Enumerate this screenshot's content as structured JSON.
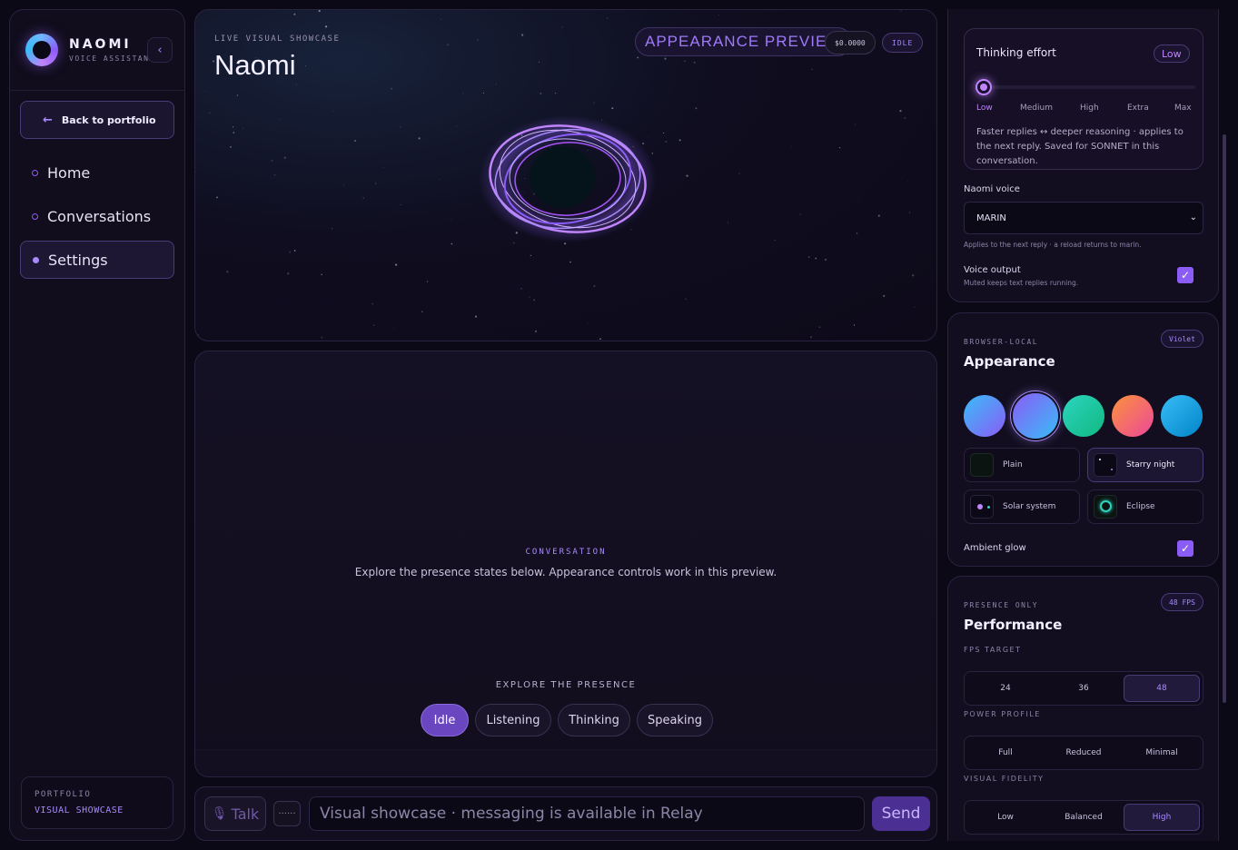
{
  "brand": {
    "name": "NAOMI",
    "subtitle": "VOICE ASSISTANT",
    "collapse_icon": "‹"
  },
  "sidebar": {
    "back_label": "Back to portfolio",
    "items": [
      {
        "label": "Home",
        "active": false
      },
      {
        "label": "Conversations",
        "active": false
      },
      {
        "label": "Settings",
        "active": true
      }
    ],
    "portfolio": {
      "label": "PORTFOLIO",
      "value": "VISUAL SHOWCASE"
    }
  },
  "showcase": {
    "eyebrow": "LIVE VISUAL SHOWCASE",
    "title": "Naomi",
    "preview_badge": "APPEARANCE PREVIEW",
    "cost": "$0.0000",
    "status": "IDLE"
  },
  "conversation": {
    "label": "CONVERSATION",
    "text": "Explore the presence states below. Appearance controls work in this preview.",
    "explore_label": "EXPLORE THE PRESENCE",
    "states": [
      "Idle",
      "Listening",
      "Thinking",
      "Speaking"
    ],
    "active_state": "Idle"
  },
  "composer": {
    "talk_label": "Talk",
    "dots": "······",
    "placeholder": "Visual showcase · messaging is available in Relay",
    "send_label": "Send"
  },
  "thinking": {
    "title": "Thinking effort",
    "badge": "Low",
    "ticks": [
      "Low",
      "Medium",
      "High",
      "Extra",
      "Max"
    ],
    "level": 0,
    "hint": "Faster replies ↔ deeper reasoning · applies to the next reply. Saved for SONNET in this conversation."
  },
  "voice": {
    "label": "Naomi voice",
    "selected": "MARIN",
    "hint": "Applies to the next reply · a reload returns to marin.",
    "output_label": "Voice output",
    "output_hint": "Muted keeps text replies running.",
    "output_enabled": true
  },
  "appearance": {
    "eyebrow": "BROWSER-LOCAL",
    "title": "Appearance",
    "badge": "Violet",
    "swatches": [
      {
        "name": "swatch-1",
        "from": "#38bdf8",
        "to": "#8b5cf6"
      },
      {
        "name": "swatch-2",
        "from": "#8b5cf6",
        "to": "#38bdf8",
        "selected": true
      },
      {
        "name": "swatch-3",
        "from": "#2dd4bf",
        "to": "#10b981"
      },
      {
        "name": "swatch-4",
        "from": "#fb923c",
        "to": "#ec4899"
      },
      {
        "name": "swatch-5",
        "from": "#38bdf8",
        "to": "#0ea5e9"
      }
    ],
    "backgrounds": [
      "Plain",
      "Starry night",
      "Solar system",
      "Eclipse"
    ],
    "active_background": "Starry night",
    "glow_label": "Ambient glow",
    "glow_enabled": true
  },
  "performance": {
    "eyebrow": "PRESENCE ONLY",
    "title": "Performance",
    "badge": "48 FPS",
    "fps_label": "FPS TARGET",
    "fps_options": [
      "24",
      "36",
      "48"
    ],
    "fps_active": "48",
    "power_label": "POWER PROFILE",
    "power_options": [
      "Full",
      "Reduced",
      "Minimal"
    ],
    "fidelity_label": "VISUAL FIDELITY",
    "fidelity_options": [
      "Low",
      "Balanced",
      "High"
    ],
    "fidelity_active": "High"
  }
}
